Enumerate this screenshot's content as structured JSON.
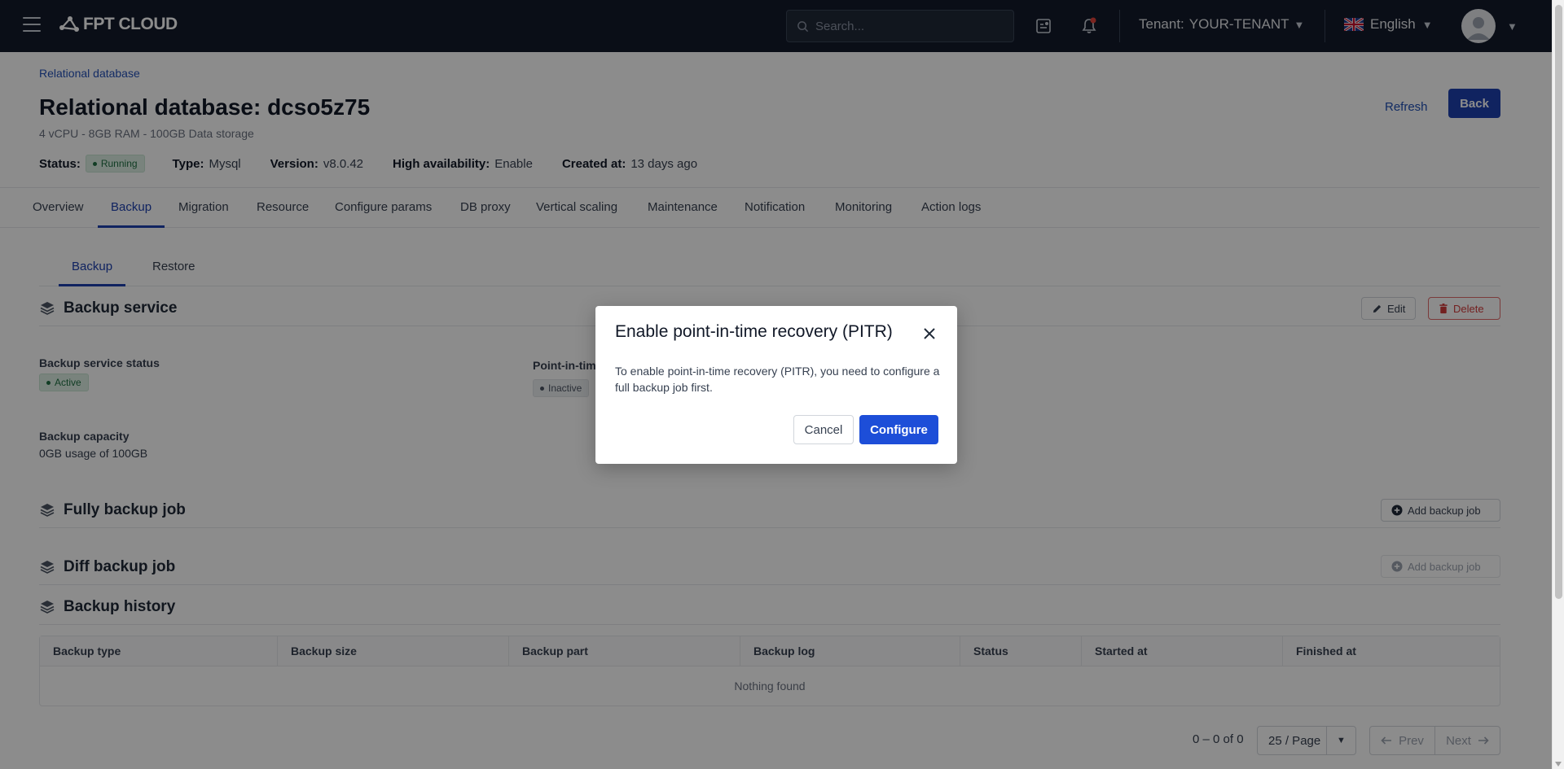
{
  "topbar": {
    "logo_text": "FPT CLOUD",
    "search_placeholder": "Search...",
    "tenant_label": "Tenant:",
    "tenant_value": "YOUR-TENANT",
    "language": "English",
    "icons": [
      "hamburger-icon",
      "tasks-icon",
      "bell-icon",
      "uk-flag-icon",
      "avatar-icon"
    ]
  },
  "header": {
    "breadcrumb": "Relational database",
    "title": "Relational database: dcso5z75",
    "subtitle": "4 vCPU - 8GB RAM - 100GB Data storage",
    "refresh_label": "Refresh",
    "back_label": "Back"
  },
  "meta": {
    "status_label": "Status:",
    "status_value": "Running",
    "type_label": "Type:",
    "type_value": "Mysql",
    "version_label": "Version:",
    "version_value": "v8.0.42",
    "ha_label": "High availability:",
    "ha_value": "Enable",
    "created_label": "Created at:",
    "created_value": "13 days ago"
  },
  "tabs": [
    {
      "label": "Overview"
    },
    {
      "label": "Backup"
    },
    {
      "label": "Migration"
    },
    {
      "label": "Resource"
    },
    {
      "label": "Configure params"
    },
    {
      "label": "DB proxy"
    },
    {
      "label": "Vertical scaling"
    },
    {
      "label": "Maintenance"
    },
    {
      "label": "Notification"
    },
    {
      "label": "Monitoring"
    },
    {
      "label": "Action logs"
    }
  ],
  "active_tab": "Backup",
  "sub_tabs": [
    {
      "label": "Backup"
    },
    {
      "label": "Restore"
    }
  ],
  "backup_service": {
    "title": "Backup service",
    "edit_label": "Edit",
    "delete_label": "Delete",
    "status_label": "Backup service status",
    "status_value": "Active",
    "pitr_label": "Point-in-tim",
    "pitr_value": "Inactive",
    "capacity_label": "Backup capacity",
    "capacity_value": "0GB usage of 100GB"
  },
  "full_backup": {
    "title": "Fully backup job",
    "add_label": "Add backup job"
  },
  "diff_backup": {
    "title": "Diff backup job",
    "add_label": "Add backup job"
  },
  "history": {
    "title": "Backup history",
    "columns": [
      "Backup type",
      "Backup size",
      "Backup part",
      "Backup log",
      "Status",
      "Started at",
      "Finished at"
    ],
    "empty_text": "Nothing found",
    "count_text": "0 – 0 of 0",
    "per_page": "25 / Page",
    "prev_label": "Prev",
    "next_label": "Next"
  },
  "modal": {
    "title": "Enable point-in-time recovery (PITR)",
    "body": "To enable point-in-time recovery (PITR), you need to configure a full backup job first.",
    "cancel_label": "Cancel",
    "configure_label": "Configure"
  },
  "colors": {
    "topbar": "#131b2b",
    "primary": "#1e40af",
    "configure": "#1d4ed8",
    "danger": "#d23b3b",
    "success_bg": "#dcefe3"
  }
}
